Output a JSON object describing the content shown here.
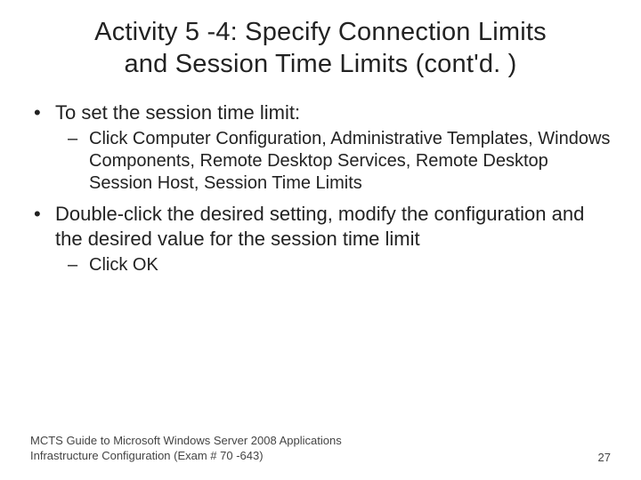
{
  "title": {
    "line1": "Activity 5 -4: Specify Connection Limits",
    "line2": "and Session Time Limits (cont'd. )"
  },
  "bullets": {
    "b1": {
      "text": "To set the session time limit:",
      "sub": {
        "s1": "Click Computer Configuration, Administrative Templates, Windows Components, Remote Desktop Services, Remote Desktop Session Host, Session Time Limits"
      }
    },
    "b2": {
      "text": "Double-click the desired setting, modify the configuration and the desired value for the session time limit",
      "sub": {
        "s1": "Click OK"
      }
    }
  },
  "footer": {
    "reference": "MCTS Guide to Microsoft Windows Server 2008 Applications Infrastructure Configuration (Exam # 70 -643)",
    "page": "27"
  }
}
